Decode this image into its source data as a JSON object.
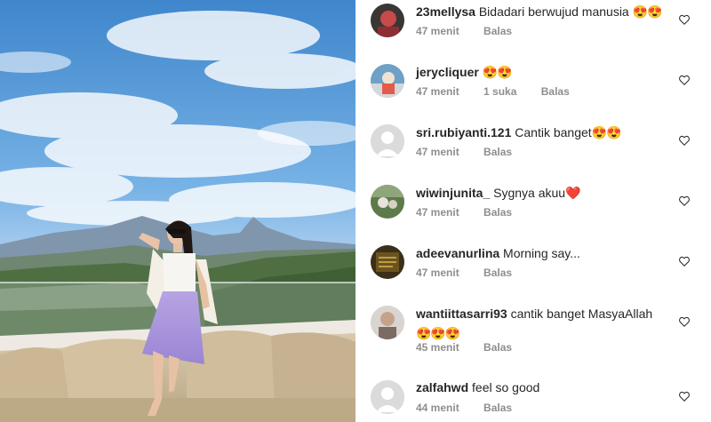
{
  "comments": [
    {
      "username": "23mellysa",
      "text": "Bidadari berwujud manusia",
      "emoji": "😍😍",
      "time": "47 menit",
      "likes": "",
      "reply": "Balas"
    },
    {
      "username": "jerycliquer",
      "text": "",
      "emoji": "😍😍",
      "time": "47 menit",
      "likes": "1 suka",
      "reply": "Balas"
    },
    {
      "username": "sri.rubiyanti.121",
      "text": "Cantik banget",
      "emoji": "😍😍",
      "time": "47 menit",
      "likes": "",
      "reply": "Balas"
    },
    {
      "username": "wiwinjunita_",
      "text": "Sygnya akuu",
      "emoji": "❤️",
      "time": "47 menit",
      "likes": "",
      "reply": "Balas"
    },
    {
      "username": "adeevanurlina",
      "text": "Morning say...",
      "emoji": "",
      "time": "47 menit",
      "likes": "",
      "reply": "Balas"
    },
    {
      "username": "wantiittasarri93",
      "text": "cantik banget MasyaAllah",
      "emoji": "😍😍😍",
      "time": "45 menit",
      "likes": "",
      "reply": "Balas"
    },
    {
      "username": "zalfahwd",
      "text": "feel so good",
      "emoji": "",
      "time": "44 menit",
      "likes": "",
      "reply": "Balas"
    }
  ],
  "icons": {
    "like": "heart-outline-icon"
  }
}
